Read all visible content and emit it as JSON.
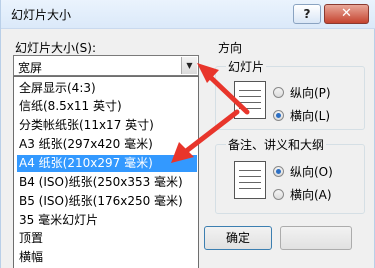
{
  "window": {
    "title": "幻灯片大小",
    "help": "?",
    "close": "✕"
  },
  "size": {
    "label": "幻灯片大小(S):",
    "value": "宽屏",
    "options": [
      "全屏显示(4:3)",
      "信纸(8.5x11 英寸)",
      "分类帐纸张(11x17 英寸)",
      "A3 纸张(297x420 毫米)",
      "A4 纸张(210x297 毫米)",
      "B4 (ISO)纸张(250x353 毫米)",
      "B5 (ISO)纸张(176x250 毫米)",
      "35 毫米幻灯片",
      "顶置",
      "横幅"
    ],
    "selected_index": 4
  },
  "orientation": {
    "label": "方向",
    "slides": {
      "title": "幻灯片",
      "portrait": "纵向(P)",
      "landscape": "横向(L)",
      "selected": "landscape"
    },
    "notes": {
      "title": "备注、讲义和大纲",
      "portrait": "纵向(O)",
      "landscape": "横向(A)",
      "selected": "portrait"
    }
  },
  "buttons": {
    "ok": "确定"
  },
  "colors": {
    "selection": "#3399ff",
    "annotation_arrow": "#e8352b",
    "close_button": "#c5442f"
  }
}
